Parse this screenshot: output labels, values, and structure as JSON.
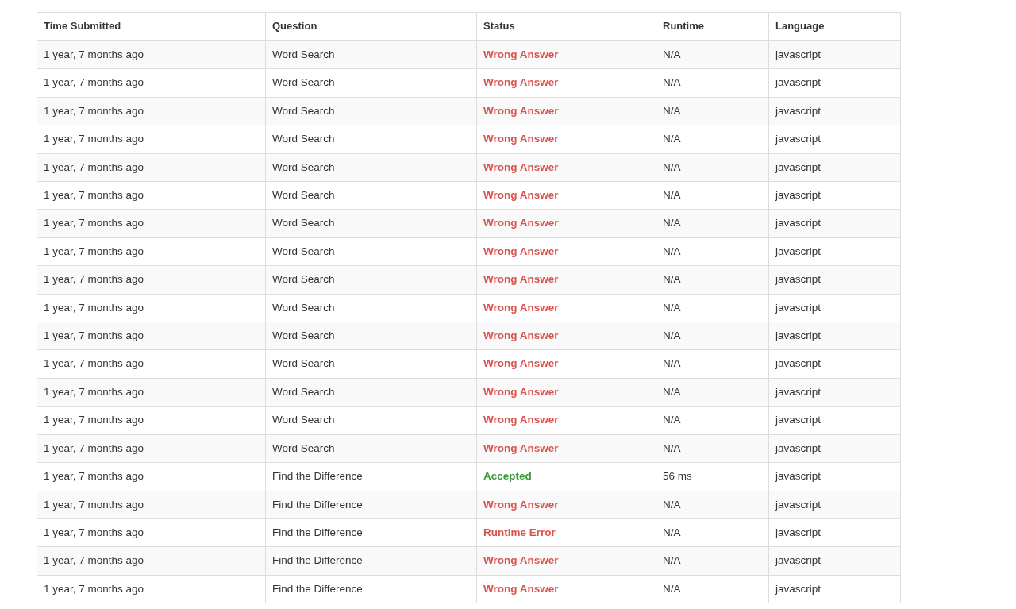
{
  "table": {
    "columns": [
      "Time Submitted",
      "Question",
      "Status",
      "Runtime",
      "Language"
    ],
    "rows": [
      {
        "time": "1 year, 7 months ago",
        "question": "Word Search",
        "status": "Wrong Answer",
        "color": "#d9534f",
        "runtime": "N/A",
        "language": "javascript"
      },
      {
        "time": "1 year, 7 months ago",
        "question": "Word Search",
        "status": "Wrong Answer",
        "color": "#d9534f",
        "runtime": "N/A",
        "language": "javascript"
      },
      {
        "time": "1 year, 7 months ago",
        "question": "Word Search",
        "status": "Wrong Answer",
        "color": "#d9534f",
        "runtime": "N/A",
        "language": "javascript"
      },
      {
        "time": "1 year, 7 months ago",
        "question": "Word Search",
        "status": "Wrong Answer",
        "color": "#d9534f",
        "runtime": "N/A",
        "language": "javascript"
      },
      {
        "time": "1 year, 7 months ago",
        "question": "Word Search",
        "status": "Wrong Answer",
        "color": "#d9534f",
        "runtime": "N/A",
        "language": "javascript"
      },
      {
        "time": "1 year, 7 months ago",
        "question": "Word Search",
        "status": "Wrong Answer",
        "color": "#d9534f",
        "runtime": "N/A",
        "language": "javascript"
      },
      {
        "time": "1 year, 7 months ago",
        "question": "Word Search",
        "status": "Wrong Answer",
        "color": "#d9534f",
        "runtime": "N/A",
        "language": "javascript"
      },
      {
        "time": "1 year, 7 months ago",
        "question": "Word Search",
        "status": "Wrong Answer",
        "color": "#d9534f",
        "runtime": "N/A",
        "language": "javascript"
      },
      {
        "time": "1 year, 7 months ago",
        "question": "Word Search",
        "status": "Wrong Answer",
        "color": "#d9534f",
        "runtime": "N/A",
        "language": "javascript"
      },
      {
        "time": "1 year, 7 months ago",
        "question": "Word Search",
        "status": "Wrong Answer",
        "color": "#d9534f",
        "runtime": "N/A",
        "language": "javascript"
      },
      {
        "time": "1 year, 7 months ago",
        "question": "Word Search",
        "status": "Wrong Answer",
        "color": "#d9534f",
        "runtime": "N/A",
        "language": "javascript"
      },
      {
        "time": "1 year, 7 months ago",
        "question": "Word Search",
        "status": "Wrong Answer",
        "color": "#d9534f",
        "runtime": "N/A",
        "language": "javascript"
      },
      {
        "time": "1 year, 7 months ago",
        "question": "Word Search",
        "status": "Wrong Answer",
        "color": "#d9534f",
        "runtime": "N/A",
        "language": "javascript"
      },
      {
        "time": "1 year, 7 months ago",
        "question": "Word Search",
        "status": "Wrong Answer",
        "color": "#d9534f",
        "runtime": "N/A",
        "language": "javascript"
      },
      {
        "time": "1 year, 7 months ago",
        "question": "Word Search",
        "status": "Wrong Answer",
        "color": "#d9534f",
        "runtime": "N/A",
        "language": "javascript"
      },
      {
        "time": "1 year, 7 months ago",
        "question": "Find the Difference",
        "status": "Accepted",
        "color": "#3c9a3c",
        "runtime": "56 ms",
        "language": "javascript"
      },
      {
        "time": "1 year, 7 months ago",
        "question": "Find the Difference",
        "status": "Wrong Answer",
        "color": "#d9534f",
        "runtime": "N/A",
        "language": "javascript"
      },
      {
        "time": "1 year, 7 months ago",
        "question": "Find the Difference",
        "status": "Runtime Error",
        "color": "#d9534f",
        "runtime": "N/A",
        "language": "javascript"
      },
      {
        "time": "1 year, 7 months ago",
        "question": "Find the Difference",
        "status": "Wrong Answer",
        "color": "#d9534f",
        "runtime": "N/A",
        "language": "javascript"
      },
      {
        "time": "1 year, 7 months ago",
        "question": "Find the Difference",
        "status": "Wrong Answer",
        "color": "#d9534f",
        "runtime": "N/A",
        "language": "javascript"
      }
    ]
  }
}
